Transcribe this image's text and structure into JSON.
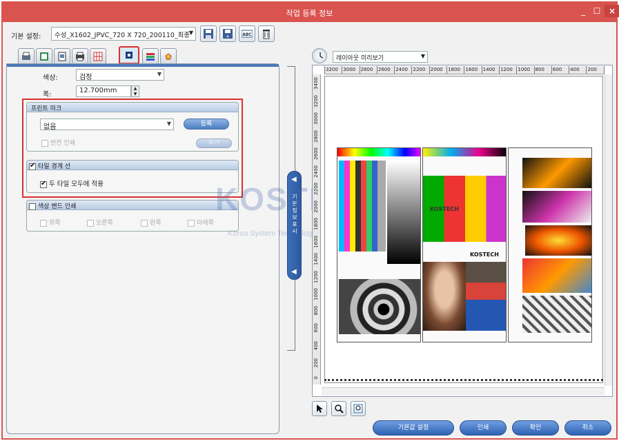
{
  "window": {
    "title": "작업 등록 정보",
    "min": "_",
    "max": "☐",
    "close": "×"
  },
  "preset": {
    "label": "기본 설정:",
    "value": "수성_X1602_JPVC_720 X 720_200110_최종"
  },
  "form": {
    "color_label": "색상:",
    "color_value": "검정",
    "width_label": "폭:",
    "width_value": "12.700mm"
  },
  "print_mark": {
    "title": "프린트 마크",
    "select_value": "없음",
    "add_button": "등록",
    "invert_label": "반전 인쇄",
    "apply_button": "추가"
  },
  "tile_line": {
    "title": "타일 경계 선",
    "apply_all_label": "두 타일 모두에 적용"
  },
  "cut_mark": {
    "title": "색상 밴드 인쇄",
    "opts": [
      "위쪽",
      "오른쪽",
      "왼쪽",
      "아래쪽"
    ]
  },
  "splitter": {
    "label": "기본 정보 표시"
  },
  "preview": {
    "mode": "레이아웃 미리보기",
    "ruler_top": [
      "3200",
      "3000",
      "2800",
      "2600",
      "2400",
      "2200",
      "2000",
      "1800",
      "1600",
      "1400",
      "1200",
      "1000",
      "800",
      "600",
      "400",
      "200",
      "0"
    ],
    "ruler_left": [
      "3400",
      "3200",
      "3000",
      "2800",
      "2600",
      "2400",
      "2200",
      "2000",
      "1800",
      "1600",
      "1400",
      "1200",
      "1000",
      "800",
      "600",
      "400",
      "200",
      "0"
    ],
    "tile_brand": "KOSTECH",
    "tile_brand2": "KOSTECH"
  },
  "watermark": {
    "main": "KOSTECH",
    "sub": "Korea System Technology Inc."
  },
  "buttons": {
    "default": "기본값 설정",
    "cancel": "인쇄",
    "ok": "확인",
    "close": "취소"
  },
  "colors": {
    "accent": "#d9534f",
    "highlight": "#d9302c",
    "button": "#2e62b3"
  }
}
